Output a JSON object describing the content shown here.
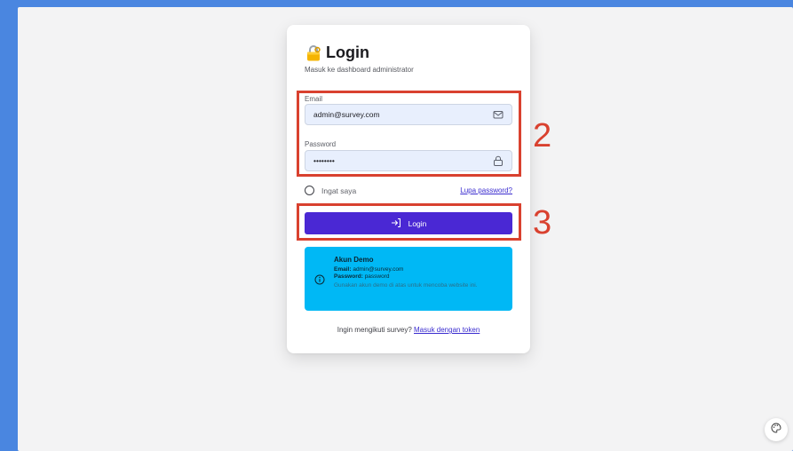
{
  "colors": {
    "page_bg": "#f3f3f4",
    "frame": "#4a86e0",
    "primary": "#4a28d4",
    "info": "#00b8f5",
    "annotation": "#d9412f"
  },
  "header": {
    "emoji_icon": "locked-with-key-emoji",
    "title": "Login",
    "subtitle": "Masuk ke dashboard administrator"
  },
  "form": {
    "email_label": "Email",
    "email_value": "admin@survey.com",
    "email_icon": "mail-icon",
    "password_label": "Password",
    "password_value": "••••••••",
    "password_icon": "lock-icon",
    "remember_label": "Ingat saya",
    "remember_checked": false,
    "forgot_link": "Lupa password?",
    "submit_label": "Login",
    "submit_icon": "login-arrow-icon"
  },
  "demo": {
    "title": "Akun Demo",
    "email_key": "Email:",
    "email_val": "admin@survey.com",
    "password_key": "Password:",
    "password_val": "password",
    "note": "Gunakan akun demo di atas untuk mencoba website ini."
  },
  "footer": {
    "prompt": "Ingin mengikuti survey?",
    "token_link": "Masuk dengan token"
  },
  "annotations": {
    "box_credentials": "2",
    "box_login": "3"
  },
  "theme_button_icon": "palette-icon"
}
